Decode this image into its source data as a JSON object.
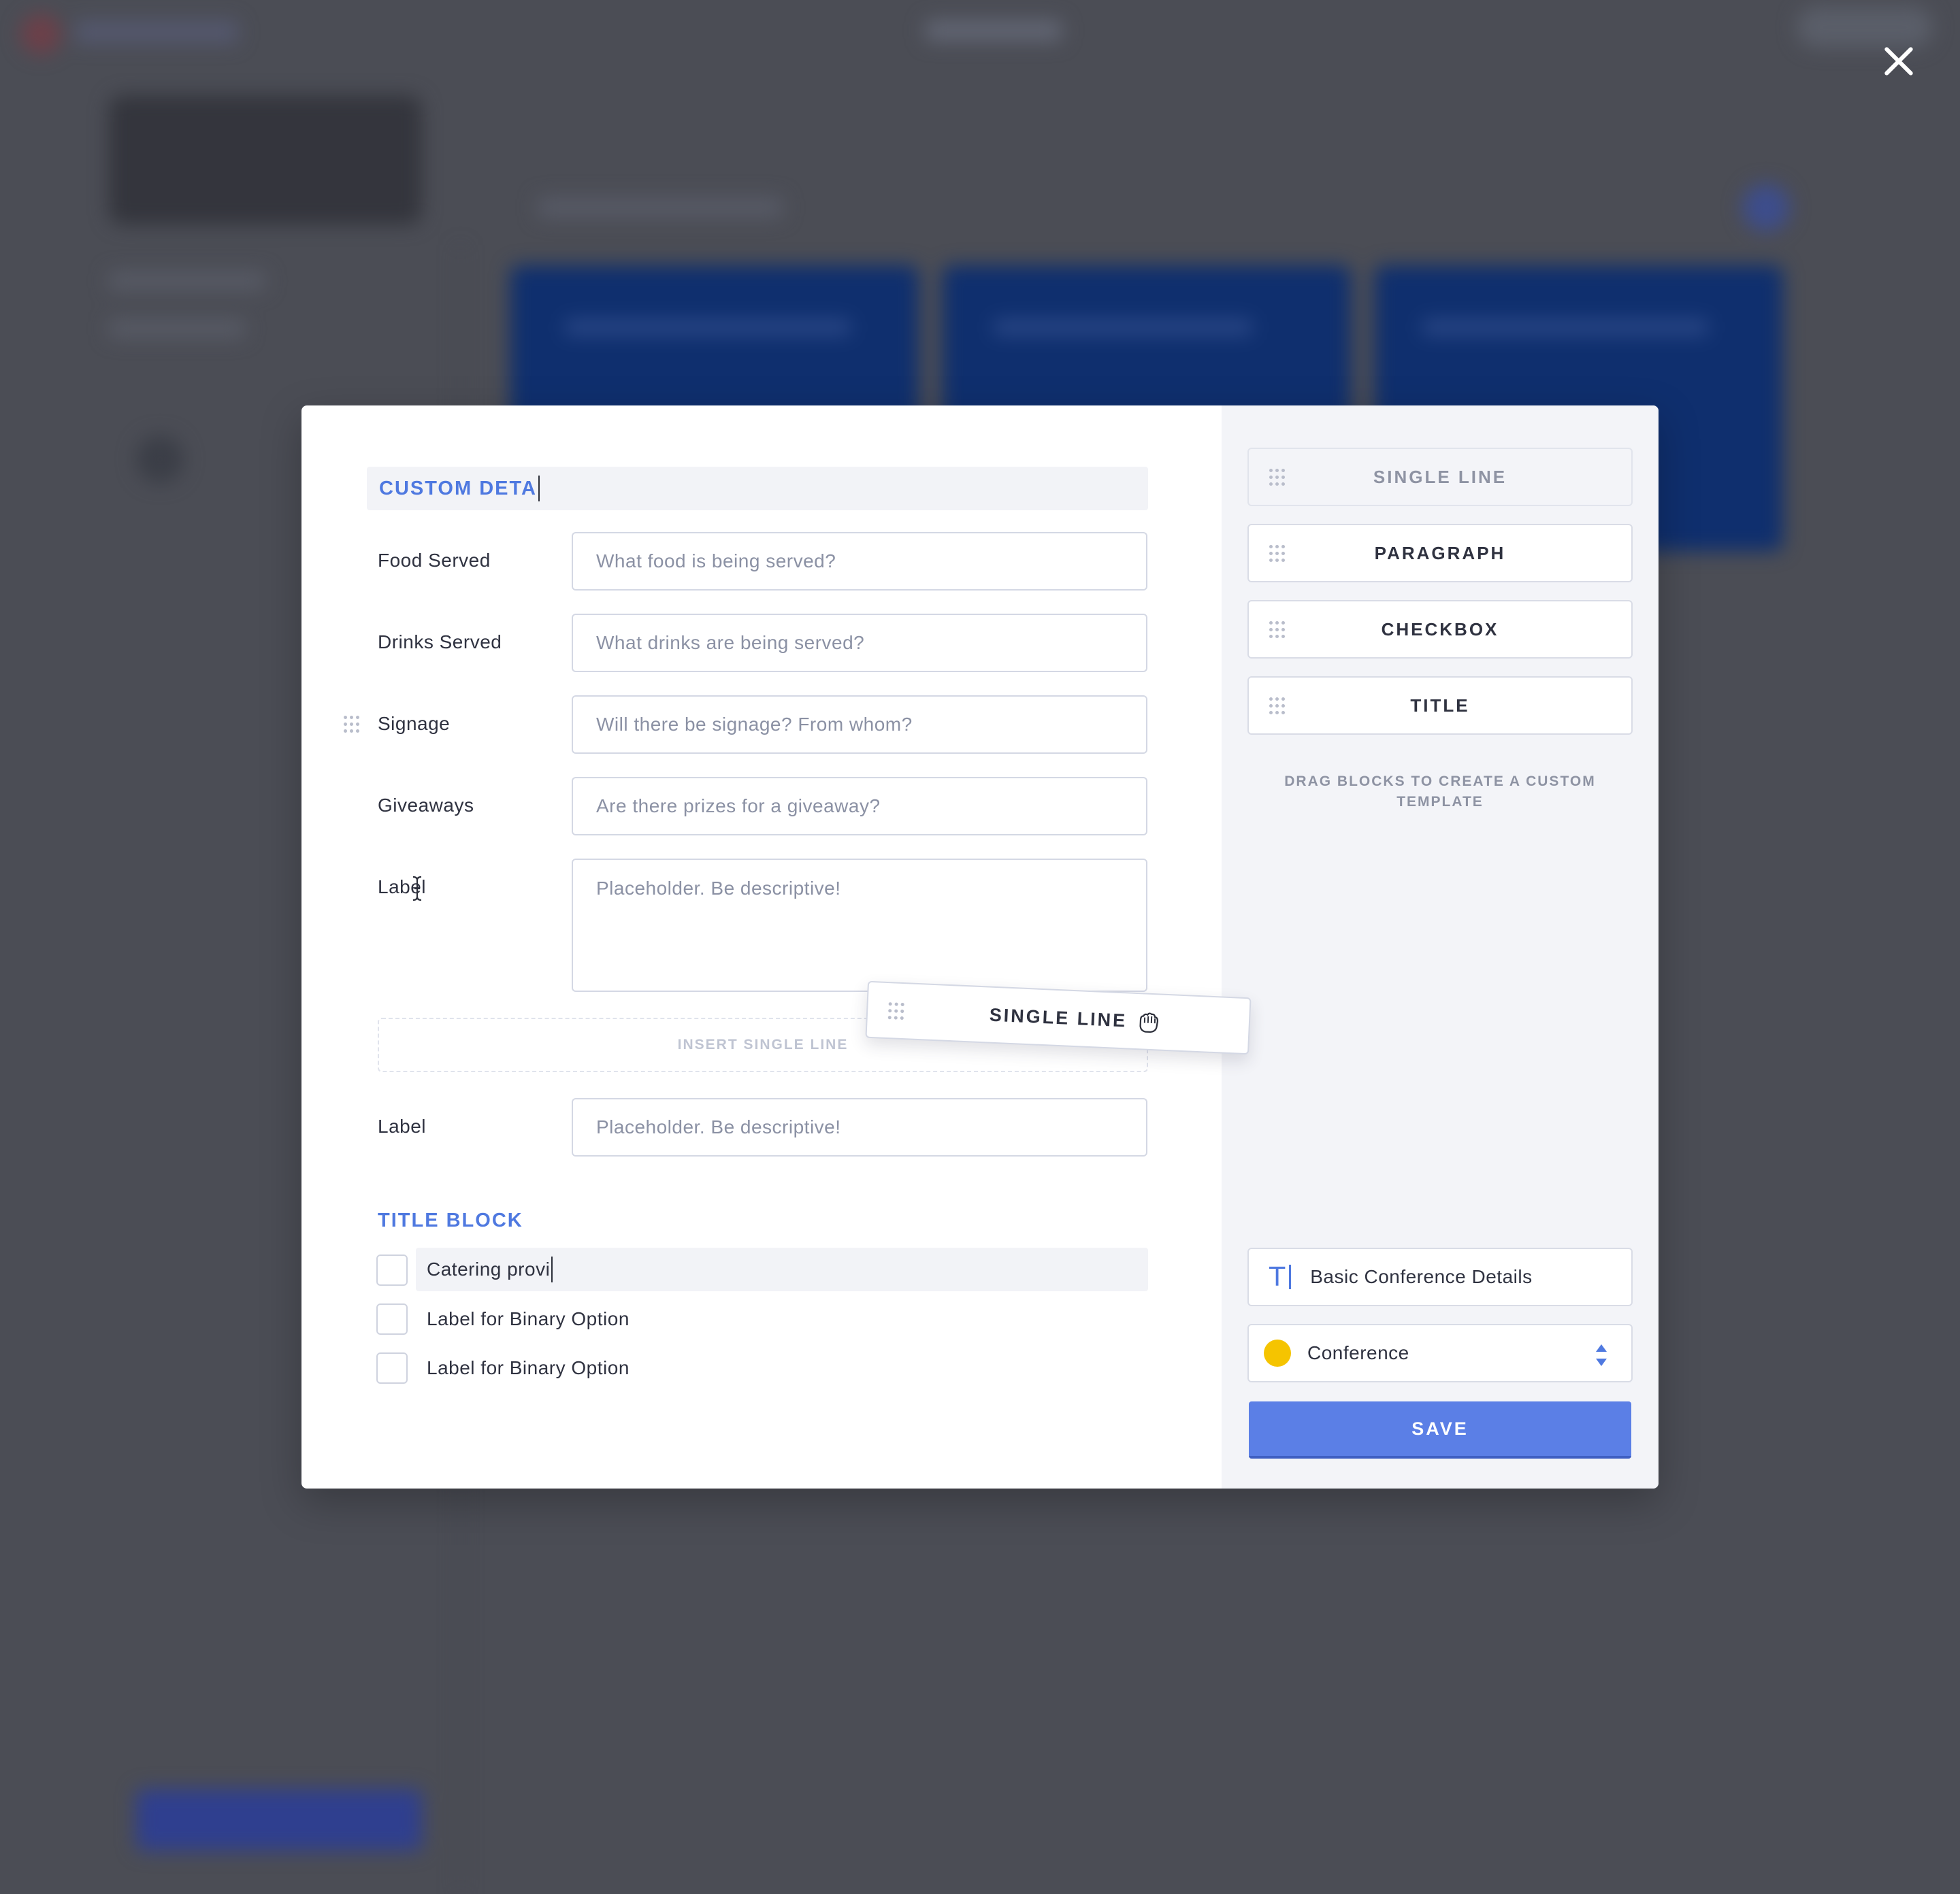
{
  "form": {
    "section_title": "CUSTOM DETA",
    "fields": [
      {
        "label": "Food Served",
        "placeholder": "What food is being served?"
      },
      {
        "label": "Drinks Served",
        "placeholder": "What drinks are being served?"
      },
      {
        "label": "Signage",
        "placeholder": "Will there be signage? From whom?"
      },
      {
        "label": "Giveaways",
        "placeholder": "Are there prizes for a giveaway?"
      },
      {
        "label": "Label",
        "placeholder": "Placeholder. Be descriptive!"
      },
      {
        "label": "Label",
        "placeholder": "Placeholder. Be descriptive!"
      }
    ],
    "insert_zone_text": "INSERT SINGLE LINE",
    "dragging_block_label": "SINGLE LINE",
    "title_block_label": "TITLE BLOCK",
    "checkboxes": [
      {
        "label": "Catering provi",
        "checked": false
      },
      {
        "label": "Label for Binary Option",
        "checked": false
      },
      {
        "label": "Label for Binary Option",
        "checked": false
      }
    ]
  },
  "sidebar": {
    "blocks": [
      {
        "label": "SINGLE LINE",
        "icon": "drag-handle-icon"
      },
      {
        "label": "PARAGRAPH",
        "icon": "drag-handle-icon"
      },
      {
        "label": "CHECKBOX",
        "icon": "drag-handle-icon"
      },
      {
        "label": "TITLE",
        "icon": "drag-handle-icon"
      }
    ],
    "hint": "DRAG BLOCKS TO CREATE A CUSTOM TEMPLATE",
    "template_name": "Basic Conference Details",
    "category": "Conference",
    "category_color": "#f5c400",
    "save_label": "SAVE"
  },
  "colors": {
    "accent": "#4f79e0",
    "save_button": "#5b7fe6",
    "overlay": "#4b4d55"
  }
}
